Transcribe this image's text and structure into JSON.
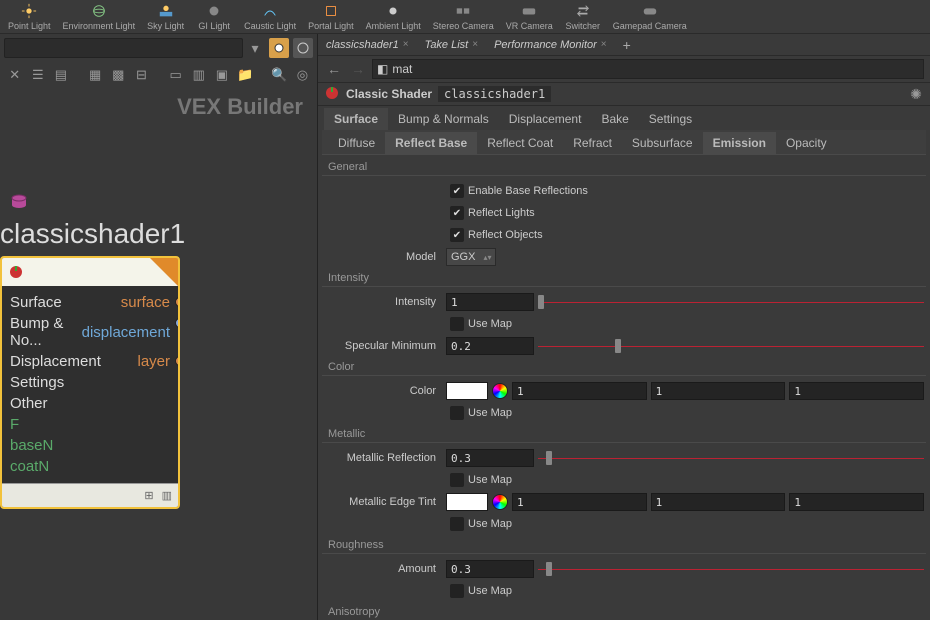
{
  "shelf": [
    {
      "label": "Point Light",
      "icon": "point-light"
    },
    {
      "label": "Environment Light",
      "icon": "env-light"
    },
    {
      "label": "Sky Light",
      "icon": "sky-light"
    },
    {
      "label": "GI Light",
      "icon": "gi-light"
    },
    {
      "label": "Caustic Light",
      "icon": "caustic-light"
    },
    {
      "label": "Portal Light",
      "icon": "portal-light"
    },
    {
      "label": "Ambient Light",
      "icon": "ambient-light"
    },
    {
      "label": "Stereo Camera",
      "icon": "stereo-cam"
    },
    {
      "label": "VR Camera",
      "icon": "vr-cam"
    },
    {
      "label": "Switcher",
      "icon": "switcher"
    },
    {
      "label": "Gamepad Camera",
      "icon": "gamepad"
    }
  ],
  "left": {
    "title": "VEX Builder",
    "node_name": "classicshader1",
    "rows": [
      {
        "l": "Surface",
        "r": "surface",
        "rc": "#d78a4a",
        "port": "#d78a4a"
      },
      {
        "l": "Bump & No...",
        "r": "displacement",
        "rc": "#6fa8d8",
        "port": "#8aa8d8"
      },
      {
        "l": "Displacement",
        "r": "layer",
        "rc": "#d78a4a",
        "port": "#d78a4a"
      },
      {
        "l": "Settings",
        "r": ""
      },
      {
        "l": "Other",
        "r": ""
      },
      {
        "l": "F",
        "r": "",
        "lc": "#5aaa6a"
      },
      {
        "l": "baseN",
        "r": "",
        "lc": "#5aaa6a"
      },
      {
        "l": "coatN",
        "r": "",
        "lc": "#5aaa6a"
      }
    ]
  },
  "tabs": [
    {
      "label": "classicshader1"
    },
    {
      "label": "Take List"
    },
    {
      "label": "Performance Monitor"
    }
  ],
  "path": "mat",
  "header": {
    "type": "Classic Shader",
    "name": "classicshader1"
  },
  "param_tabs": [
    "Surface",
    "Bump & Normals",
    "Displacement",
    "Bake",
    "Settings"
  ],
  "sub_tabs": [
    "Diffuse",
    "Reflect Base",
    "Reflect Coat",
    "Refract",
    "Subsurface",
    "Emission",
    "Opacity"
  ],
  "active_ptab": 0,
  "active_stab": 1,
  "general": {
    "group": "General",
    "enable": {
      "label": "Enable Base Reflections",
      "v": true
    },
    "lights": {
      "label": "Reflect Lights",
      "v": true
    },
    "objects": {
      "label": "Reflect Objects",
      "v": true
    },
    "model": {
      "label": "Model",
      "value": "GGX"
    }
  },
  "intensity": {
    "group": "Intensity",
    "intensity": {
      "label": "Intensity",
      "value": "1",
      "slider": 0
    },
    "usemap1": "Use Map",
    "specmin": {
      "label": "Specular Minimum",
      "value": "0.2",
      "slider": 0.2
    }
  },
  "color": {
    "group": "Color",
    "color": {
      "label": "Color",
      "r": "1",
      "g": "1",
      "b": "1"
    },
    "usemap": "Use Map"
  },
  "metallic": {
    "group": "Metallic",
    "refl": {
      "label": "Metallic Reflection",
      "value": "0.3",
      "slider": 0.02
    },
    "usemap1": "Use Map",
    "tint": {
      "label": "Metallic Edge Tint",
      "r": "1",
      "g": "1",
      "b": "1"
    },
    "usemap2": "Use Map"
  },
  "roughness": {
    "group": "Roughness",
    "amount": {
      "label": "Amount",
      "value": "0.3",
      "slider": 0.02
    },
    "usemap": "Use Map"
  },
  "anisotropy": {
    "group": "Anisotropy"
  }
}
